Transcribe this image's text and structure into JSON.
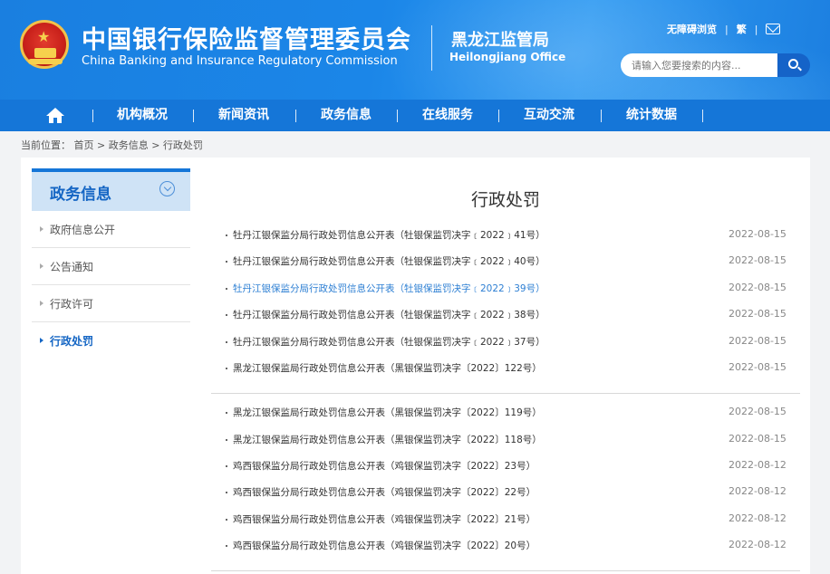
{
  "header": {
    "title_cn": "中国银行保险监督管理委员会",
    "title_en": "China Banking and Insurance Regulatory Commission",
    "office_cn": "黑龙江监管局",
    "office_en": "Heilongjiang Office",
    "accessibility_label": "无障碍浏览",
    "traditional_label": "繁",
    "mail_icon": "mail-icon",
    "search_placeholder": "请输入您要搜索的内容...",
    "search_icon": "search-icon",
    "emblem_icon": "national-emblem"
  },
  "nav": {
    "home_icon": "home-icon",
    "items": [
      "机构概况",
      "新闻资讯",
      "政务信息",
      "在线服务",
      "互动交流",
      "统计数据"
    ]
  },
  "breadcrumb": "当前位置： 首页 > 政务信息 > 行政处罚",
  "sidebar": {
    "title": "政务信息",
    "toggle_icon": "chevron-down-icon",
    "items": [
      {
        "label": "政府信息公开",
        "active": false
      },
      {
        "label": "公告通知",
        "active": false
      },
      {
        "label": "行政许可",
        "active": false
      },
      {
        "label": "行政处罚",
        "active": true
      }
    ]
  },
  "main": {
    "title": "行政处罚",
    "groups": [
      [
        {
          "text": "牡丹江银保监分局行政处罚信息公开表（牡银保监罚决字﹝2022﹞41号）",
          "date": "2022-08-15"
        },
        {
          "text": "牡丹江银保监分局行政处罚信息公开表（牡银保监罚决字﹝2022﹞40号）",
          "date": "2022-08-15"
        },
        {
          "text": "牡丹江银保监分局行政处罚信息公开表（牡银保监罚决字﹝2022﹞39号）",
          "date": "2022-08-15",
          "highlight": true
        },
        {
          "text": "牡丹江银保监分局行政处罚信息公开表（牡银保监罚决字﹝2022﹞38号）",
          "date": "2022-08-15"
        },
        {
          "text": "牡丹江银保监分局行政处罚信息公开表（牡银保监罚决字﹝2022﹞37号）",
          "date": "2022-08-15"
        },
        {
          "text": "黑龙江银保监局行政处罚信息公开表（黑银保监罚决字〔2022〕122号）",
          "date": "2022-08-15"
        }
      ],
      [
        {
          "text": "黑龙江银保监局行政处罚信息公开表（黑银保监罚决字〔2022〕119号）",
          "date": "2022-08-15"
        },
        {
          "text": "黑龙江银保监局行政处罚信息公开表（黑银保监罚决字〔2022〕118号）",
          "date": "2022-08-15"
        },
        {
          "text": "鸡西银保监分局行政处罚信息公开表（鸡银保监罚决字〔2022〕23号）",
          "date": "2022-08-12"
        },
        {
          "text": "鸡西银保监分局行政处罚信息公开表（鸡银保监罚决字〔2022〕22号）",
          "date": "2022-08-12"
        },
        {
          "text": "鸡西银保监分局行政处罚信息公开表（鸡银保监罚决字〔2022〕21号）",
          "date": "2022-08-12"
        },
        {
          "text": "鸡西银保监分局行政处罚信息公开表（鸡银保监罚决字〔2022〕20号）",
          "date": "2022-08-12"
        }
      ]
    ]
  }
}
